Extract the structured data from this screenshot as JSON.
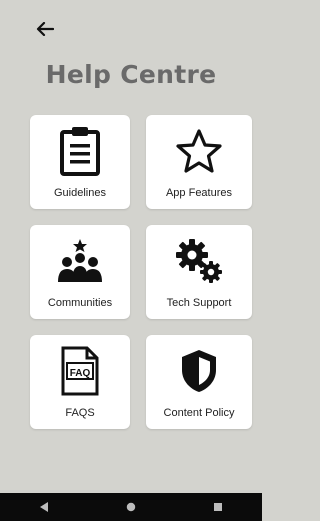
{
  "header": {
    "back_icon": "arrow-left-icon",
    "title": "Help Centre"
  },
  "cards": [
    {
      "label": "Guidelines",
      "icon": "clipboard-icon"
    },
    {
      "label": "App Features",
      "icon": "star-icon"
    },
    {
      "label": "Communities",
      "icon": "group-icon"
    },
    {
      "label": "Tech Support",
      "icon": "gears-icon"
    },
    {
      "label": "FAQS",
      "icon": "faq-document-icon"
    },
    {
      "label": "Content Policy",
      "icon": "shield-icon"
    }
  ],
  "navbar": {
    "icons": [
      "nav-back-icon",
      "nav-home-icon",
      "nav-recents-icon"
    ]
  }
}
